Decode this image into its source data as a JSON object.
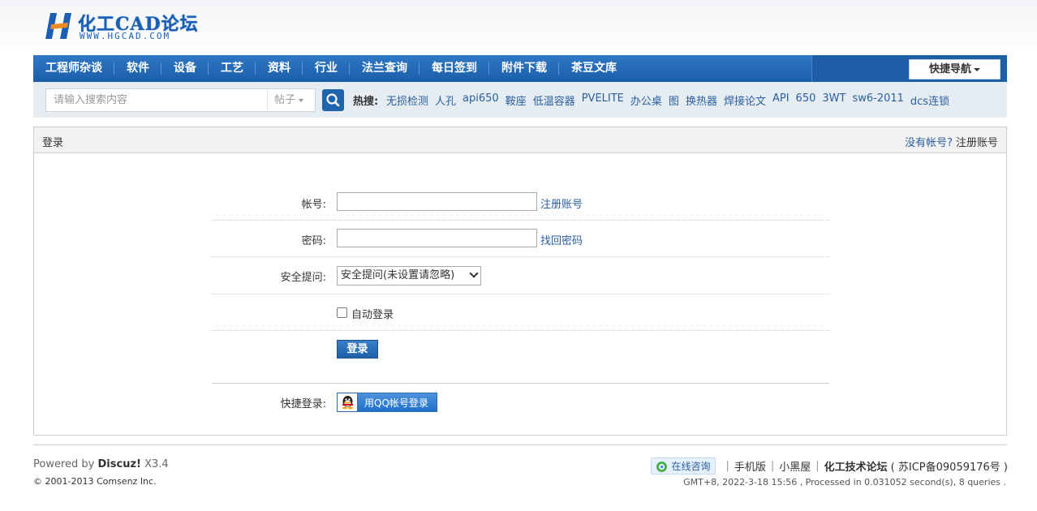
{
  "logo": {
    "title": "化工CAD论坛",
    "subtitle": "WWW.HGCAD.COM"
  },
  "nav": {
    "items": [
      "工程师杂谈",
      "软件",
      "设备",
      "工艺",
      "资料",
      "行业",
      "法兰查询",
      "每日签到",
      "附件下载",
      "茶豆文库"
    ],
    "quick_nav": "快捷导航"
  },
  "search": {
    "placeholder": "请输入搜索内容",
    "type": "帖子",
    "hot_label": "热搜:",
    "hot_items": [
      "无损检测",
      "人孔",
      "api650",
      "鞍座",
      "低温容器",
      "PVELITE",
      "办公桌",
      "图",
      "换热器",
      "焊接论文",
      "API",
      "650",
      "3WT",
      "sw6-2011",
      "dcs连锁"
    ]
  },
  "login": {
    "title": "登录",
    "no_account": "没有帐号?",
    "register_link": "注册账号",
    "account_label": "帐号:",
    "account_link": "注册账号",
    "password_label": "密码:",
    "password_link": "找回密码",
    "question_label": "安全提问:",
    "question_selected": "安全提问(未设置请忽略)",
    "auto_login": "自动登录",
    "submit": "登录",
    "quick_login_label": "快捷登录:",
    "qq_login": "用QQ帐号登录"
  },
  "footer": {
    "powered_by": "Powered by",
    "product": "Discuz!",
    "version": "X3.4",
    "copyright": "© 2001-2013 Comsenz Inc.",
    "consult": "在线咨询",
    "mobile": "手机版",
    "blackroom": "小黑屋",
    "site_name": "化工技术论坛",
    "icp": "( 苏ICP备09059176号 )",
    "meta": "GMT+8, 2022-3-18 15:56 , Processed in 0.031052 second(s), 8 queries ."
  },
  "colors": {
    "nav_blue": "#1b5eaa",
    "link_blue": "#2b5e9e",
    "search_bg": "#e5edf2"
  }
}
